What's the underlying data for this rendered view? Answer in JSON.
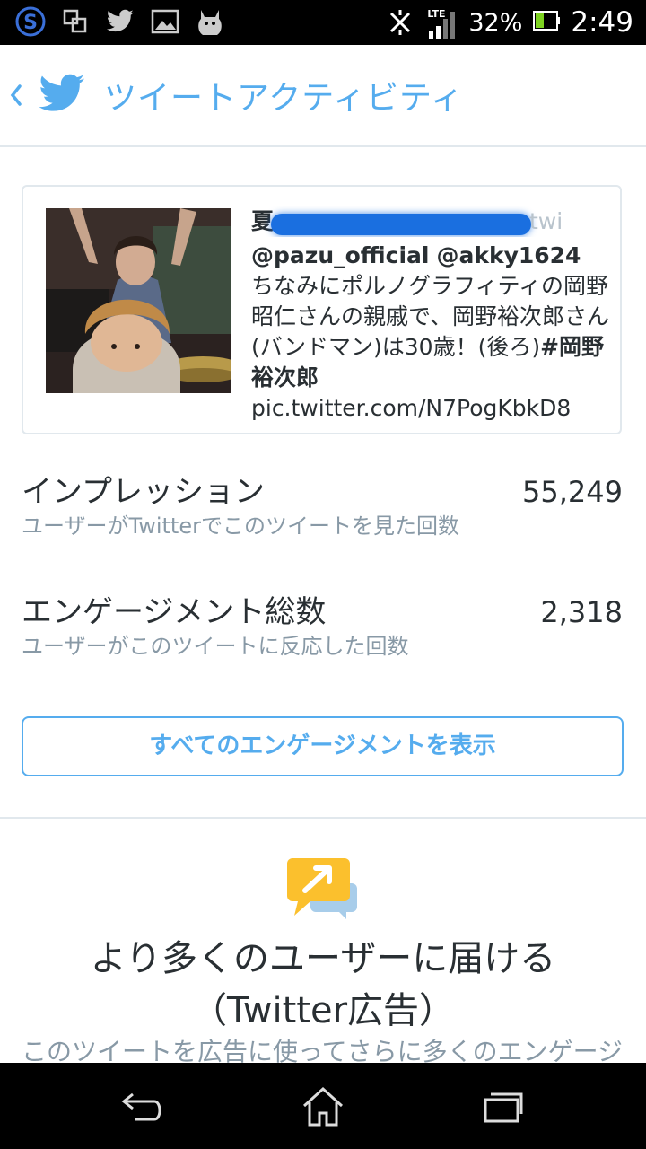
{
  "status_bar": {
    "battery_percent": "32%",
    "time": "2:49",
    "network": "LTE",
    "icons": [
      "skype-icon",
      "screen-icon",
      "twitter-icon",
      "gallery-icon",
      "mascot-icon"
    ]
  },
  "header": {
    "title": "ツイートアクティビティ"
  },
  "tweet": {
    "name_visible": "夏",
    "handle_tail": "twi",
    "mention1": "@pazu_official",
    "mention2": "@akky1624",
    "text_part1": " ちなみにポルノグラフィティの岡野昭仁さんの親戚で、岡野裕次郎さん(バンドマン)は30歳！(後ろ)",
    "hashtag": "#岡野裕次郎",
    "link": "pic.twitter.com/N7PogKbkD8"
  },
  "metrics": {
    "impressions": {
      "label": "インプレッション",
      "value": "55,249",
      "desc": "ユーザーがTwitterでこのツイートを見た回数"
    },
    "engagements": {
      "label": "エンゲージメント総数",
      "value": "2,318",
      "desc": "ユーザーがこのツイートに反応した回数"
    }
  },
  "view_all_button": "すべてのエンゲージメントを表示",
  "promo": {
    "title": "より多くのユーザーに届ける",
    "subtitle": "（Twitter広告）",
    "desc": "このツイートを広告に使ってさらに多くのエンゲージ"
  },
  "colors": {
    "accent": "#55acee",
    "secondary_text": "#8899a6",
    "border": "#e1e8ed"
  }
}
